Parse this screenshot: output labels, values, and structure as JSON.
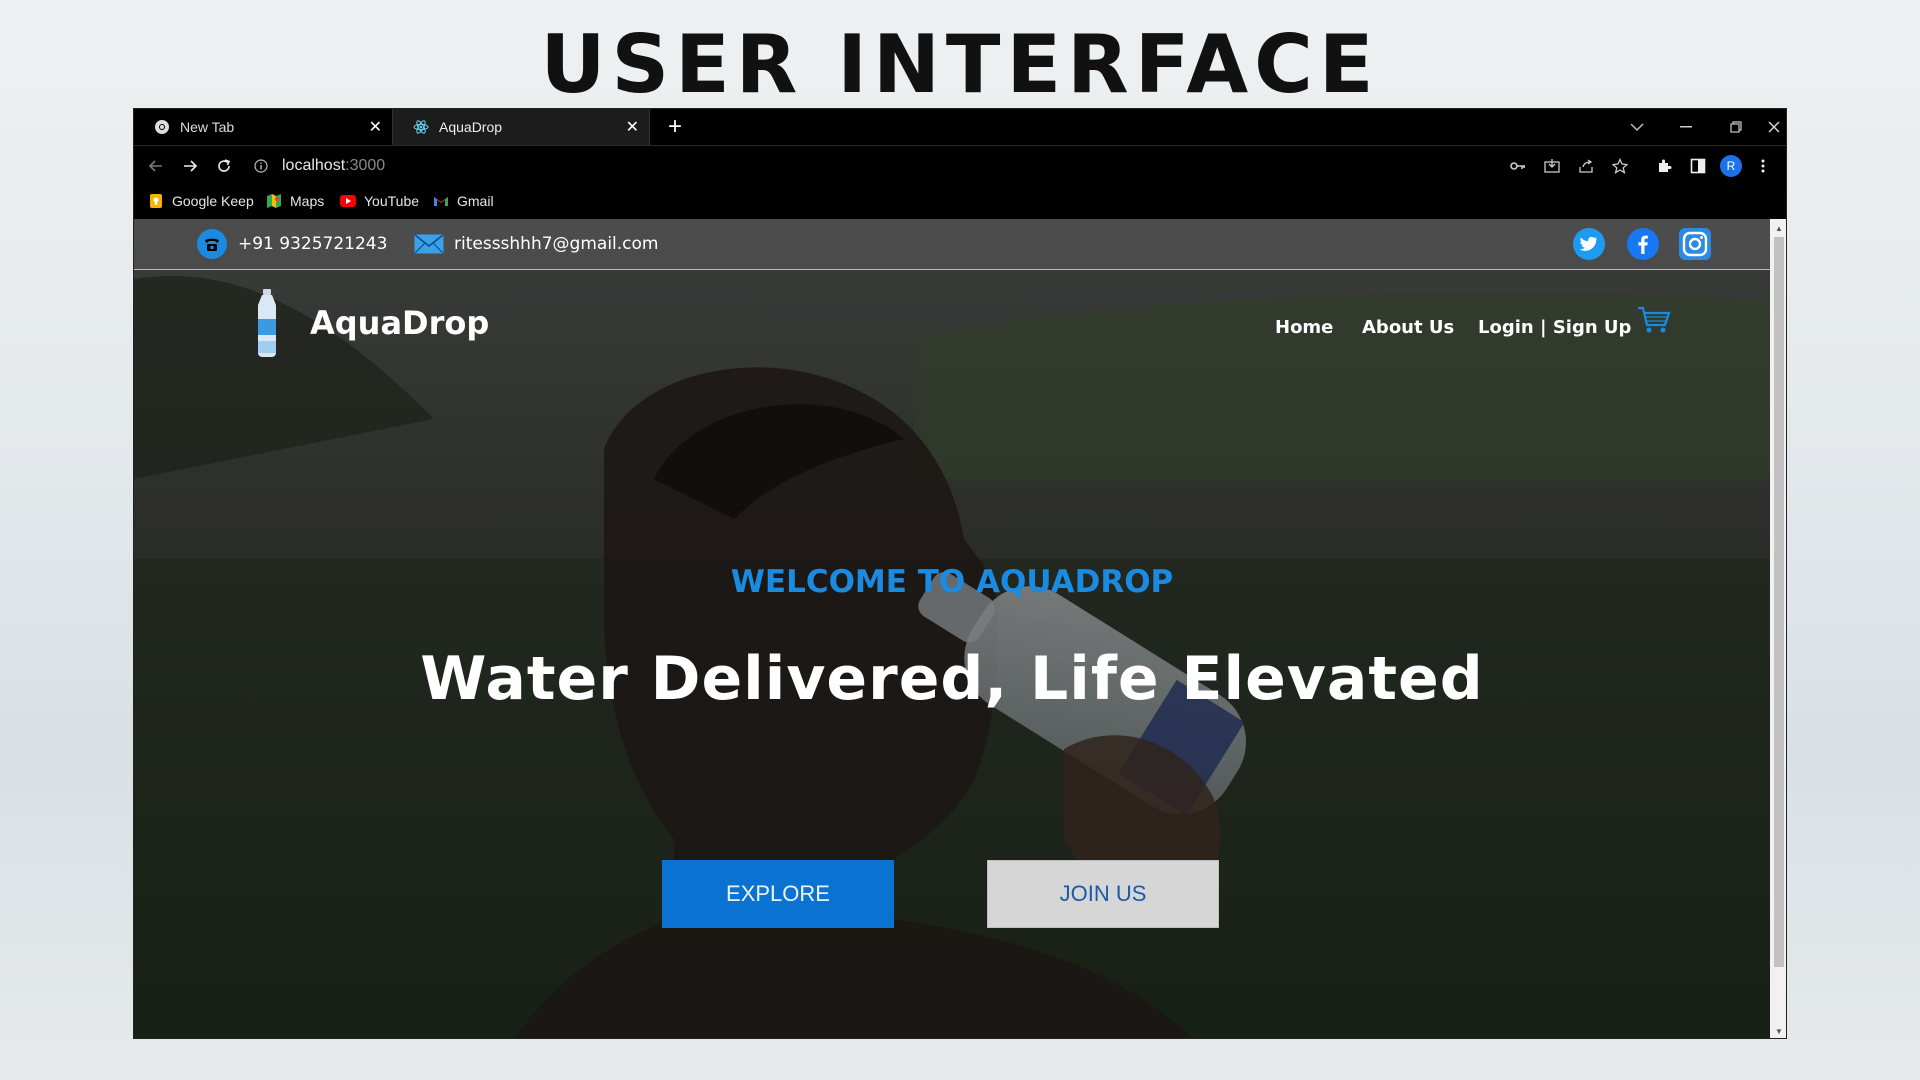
{
  "slide": {
    "title": "USER INTERFACE"
  },
  "browser": {
    "tabs": [
      {
        "label": "New Tab",
        "icon": "chrome-icon",
        "active": false
      },
      {
        "label": "AquaDrop",
        "icon": "react-icon",
        "active": true
      }
    ],
    "url_host": "localhost",
    "url_port": ":3000",
    "profile_initial": "R",
    "bookmarks": [
      {
        "label": "Google Keep",
        "icon": "google-keep-icon",
        "color": "#f6b400"
      },
      {
        "label": "Maps",
        "icon": "maps-icon",
        "color": "#34a853"
      },
      {
        "label": "YouTube",
        "icon": "youtube-icon",
        "color": "#ff0000"
      },
      {
        "label": "Gmail",
        "icon": "gmail-icon",
        "color": "#ea4335"
      }
    ]
  },
  "site": {
    "contact": {
      "phone": "+91 9325721243",
      "email": "ritessshhh7@gmail.com"
    },
    "social": [
      "twitter-icon",
      "facebook-icon",
      "instagram-icon"
    ],
    "brand": {
      "name": "AquaDrop"
    },
    "nav": {
      "home": "Home",
      "about": "About Us",
      "login": "Login | Sign Up"
    },
    "hero": {
      "kicker": "WELCOME TO AQUADROP",
      "title": "Water Delivered, Life Elevated",
      "explore": "EXPLORE",
      "join": "JOIN US"
    },
    "colors": {
      "accent": "#1a8be0",
      "primary_button": "#0a72d1",
      "secondary_button": "#d6d6d6"
    }
  }
}
